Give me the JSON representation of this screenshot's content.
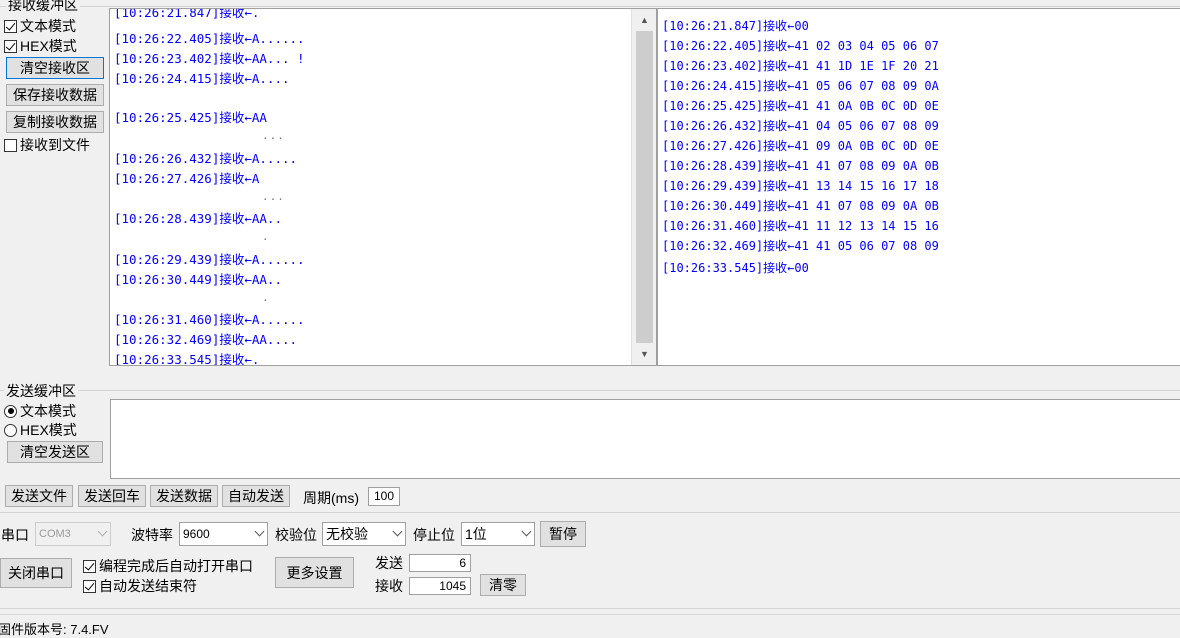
{
  "receive": {
    "title": "接收缓冲区",
    "text_mode": "文本模式",
    "hex_mode": "HEX模式",
    "clear_btn": "清空接收区",
    "save_btn": "保存接收数据",
    "copy_btn": "复制接收数据",
    "to_file": "接收到文件",
    "text_pane_lines": [
      "[10:26:21.847]接收←.",
      "[10:26:22.405]接收←A......",
      "[10:26:23.402]接收←AA... !",
      "[10:26:24.415]接收←A....",
      "[10:26:25.425]接收←AA",
      "[10:26:26.432]接收←A.....",
      "[10:26:27.426]接收←A",
      "[10:26:28.439]接收←AA..",
      "[10:26:29.439]接收←A......",
      "[10:26:30.449]接收←AA..",
      "[10:26:31.460]接收←A......",
      "[10:26:32.469]接收←AA....",
      "[10:26:33.545]接收←."
    ],
    "continuation_dots": [
      "...",
      "...",
      ".",
      "."
    ],
    "hex_pane_lines": [
      "[10:26:21.847]接收←00",
      "[10:26:22.405]接收←41 02 03 04 05 06 07",
      "[10:26:23.402]接收←41 41 1D 1E 1F 20 21",
      "[10:26:24.415]接收←41 05 06 07 08 09 0A",
      "[10:26:25.425]接收←41 41 0A 0B 0C 0D 0E",
      "[10:26:26.432]接收←41 04 05 06 07 08 09",
      "[10:26:27.426]接收←41 09 0A 0B 0C 0D 0E",
      "[10:26:28.439]接收←41 41 07 08 09 0A 0B",
      "[10:26:29.439]接收←41 13 14 15 16 17 18",
      "[10:26:30.449]接收←41 41 07 08 09 0A 0B",
      "[10:26:31.460]接收←41 11 12 13 14 15 16",
      "[10:26:32.469]接收←41 41 05 06 07 08 09",
      "[10:26:33.545]接收←00"
    ]
  },
  "send": {
    "title": "发送缓冲区",
    "text_mode": "文本模式",
    "hex_mode": "HEX模式",
    "clear_btn": "清空发送区",
    "send_text": ""
  },
  "toolbar": {
    "send_file": "发送文件",
    "send_enter": "发送回车",
    "send_data": "发送数据",
    "auto_send": "自动发送",
    "period_label": "周期(ms)",
    "period_value": "100"
  },
  "port": {
    "port_label": "串口",
    "port_value": "COM3",
    "baud_label": "波特率",
    "baud_value": "9600",
    "parity_label": "校验位",
    "parity_value": "无校验",
    "stop_label": "停止位",
    "stop_value": "1位",
    "pause_btn": "暂停",
    "close_port_btn": "关闭串口",
    "auto_open": "编程完成后自动打开串口",
    "auto_end": "自动发送结束符",
    "more_settings": "更多设置",
    "send_label": "发送",
    "send_count": "6",
    "recv_label": "接收",
    "recv_count": "1045",
    "clear_count_btn": "清零"
  },
  "status": {
    "firmware": "固件版本号: 7.4.FV"
  },
  "icons": {
    "scroll_up": "▲",
    "scroll_down": "▼"
  }
}
